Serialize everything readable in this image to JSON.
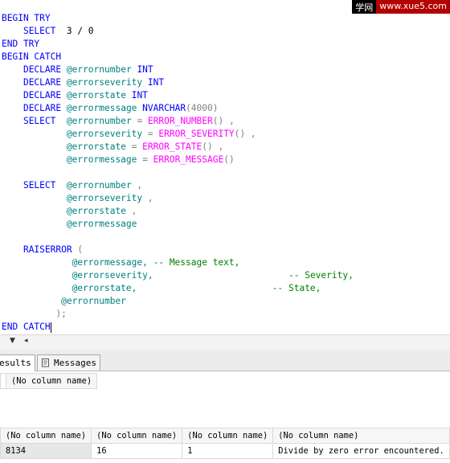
{
  "watermark": {
    "left": "学网",
    "right": "www.xue5.com"
  },
  "code": {
    "begin_try": "BEGIN TRY",
    "select_kw": "SELECT",
    "select_expr": "3 / 0",
    "end_try": "END TRY",
    "begin_catch": "BEGIN CATCH",
    "declare_kw": "DECLARE",
    "declares": [
      {
        "var": "@errornumber",
        "type": "INT"
      },
      {
        "var": "@errorseverity",
        "type": "INT"
      },
      {
        "var": "@errorstate",
        "type": "INT"
      },
      {
        "var": "@errormessage",
        "type": "NVARCHAR",
        "size": "(4000)"
      }
    ],
    "assigns": [
      {
        "var": "@errornumber",
        "fn": "ERROR_NUMBER",
        "tail": "() ,"
      },
      {
        "var": "@errorseverity",
        "fn": "ERROR_SEVERITY",
        "tail": "() ,"
      },
      {
        "var": "@errorstate",
        "fn": "ERROR_STATE",
        "tail": "() ,"
      },
      {
        "var": "@errormessage",
        "fn": "ERROR_MESSAGE",
        "tail": "()"
      }
    ],
    "selects2": [
      {
        "var": "@errornumber",
        "tail": " ,"
      },
      {
        "var": "@errorseverity",
        "tail": " ,"
      },
      {
        "var": "@errorstate",
        "tail": " ,"
      },
      {
        "var": "@errormessage",
        "tail": ""
      }
    ],
    "raiserror_kw": "RAISERROR",
    "raiserror_open": "(",
    "raise_args": [
      {
        "var": "@errormessage,",
        "comment": "-- Message text,"
      },
      {
        "var": "@errorseverity,",
        "comment": "-- Severity,"
      },
      {
        "var": "@errorstate,",
        "comment": "-- State,"
      },
      {
        "var": "@errornumber",
        "comment": ""
      }
    ],
    "raiserror_close": ");",
    "end_catch": "END CATCH"
  },
  "results_tabs": [
    {
      "label": "esults",
      "active": true,
      "icon": "results-grid-icon"
    },
    {
      "label": "Messages",
      "active": false,
      "icon": "messages-icon"
    }
  ],
  "grid1": {
    "header": "(No column name)"
  },
  "grid2": {
    "headers": [
      "(No column name)",
      "(No column name)",
      "(No column name)",
      "(No column name)"
    ],
    "rows": [
      [
        "8134",
        "16",
        "1",
        "Divide by zero error encountered."
      ]
    ]
  }
}
